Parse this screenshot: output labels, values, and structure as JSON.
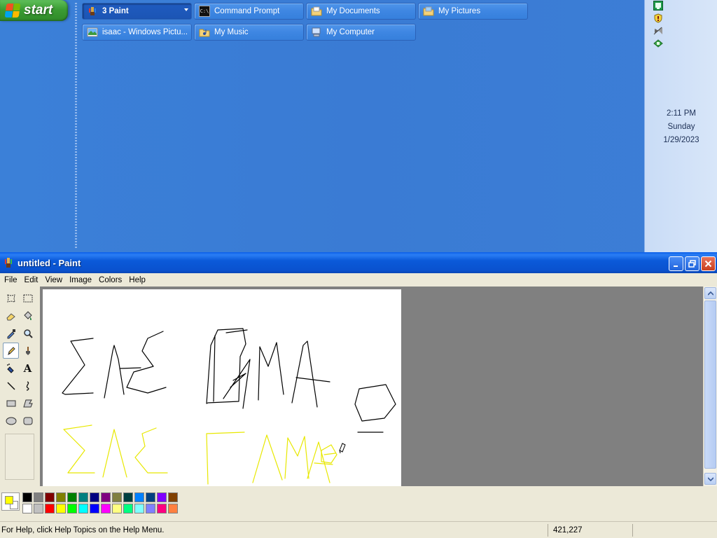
{
  "taskbar": {
    "start_label": "start",
    "buttons": [
      {
        "label": "3 Paint",
        "icon": "paint-icon",
        "active": true
      },
      {
        "label": "Command Prompt",
        "icon": "command-prompt-icon"
      },
      {
        "label": "My Documents",
        "icon": "folder-icon"
      },
      {
        "label": "My Pictures",
        "icon": "folder-icon"
      },
      {
        "label": "isaac - Windows Pictu...",
        "icon": "picture-viewer-icon"
      },
      {
        "label": "My Music",
        "icon": "folder-icon"
      },
      {
        "label": "My Computer",
        "icon": "computer-icon"
      }
    ],
    "tray": {
      "icons": [
        "network-icon",
        "security-shield-icon",
        "satellite-icon",
        "update-icon"
      ],
      "time": "2:11 PM",
      "day": "Sunday",
      "date": "1/29/2023"
    }
  },
  "paint": {
    "title": "untitled - Paint",
    "menu": [
      "File",
      "Edit",
      "View",
      "Image",
      "Colors",
      "Help"
    ],
    "tools": [
      "free-form-select-icon",
      "select-icon",
      "eraser-icon",
      "fill-icon",
      "pick-color-icon",
      "magnifier-icon",
      "pencil-icon",
      "brush-icon",
      "airbrush-icon",
      "text-icon",
      "line-icon",
      "curve-icon",
      "rectangle-icon",
      "polygon-icon",
      "ellipse-icon",
      "rounded-rectangle-icon"
    ],
    "selected_tool": "pencil-icon",
    "foreground_color": "#ffff00",
    "background_color": "#ffffff",
    "palette_top": [
      "#000000",
      "#808080",
      "#800000",
      "#808000",
      "#008000",
      "#008080",
      "#000080",
      "#800080",
      "#808040",
      "#004040",
      "#0080ff",
      "#004080",
      "#8000ff",
      "#804000"
    ],
    "palette_bottom": [
      "#ffffff",
      "#c0c0c0",
      "#ff0000",
      "#ffff00",
      "#00ff00",
      "#00ffff",
      "#0000ff",
      "#ff00ff",
      "#ffff80",
      "#00ff80",
      "#80ffff",
      "#8080ff",
      "#ff0080",
      "#ff8040"
    ],
    "status_help": "For Help, click Help Topics on the Help Menu.",
    "status_coords": "421,227"
  }
}
